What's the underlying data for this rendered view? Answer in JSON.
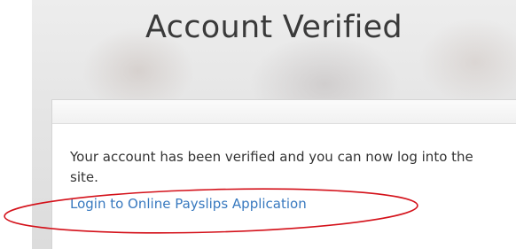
{
  "header": {
    "title": "Account Verified"
  },
  "panel": {
    "message": "Your account has been verified and you can now log into the site.",
    "login_link": "Login to Online Payslips Application"
  },
  "colors": {
    "link": "#3879bf",
    "annotation_ellipse": "#d4111a",
    "title_text": "#3a3a3a"
  }
}
